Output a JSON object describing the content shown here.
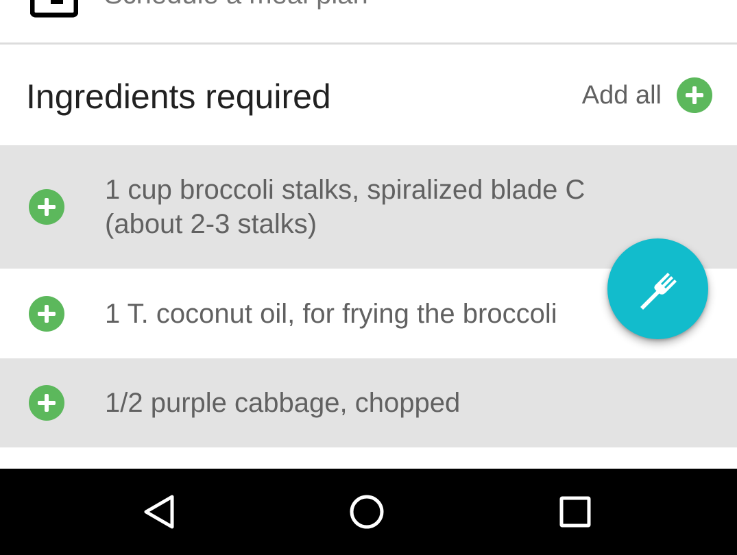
{
  "top_row": {
    "label": "Schedule a meal plan",
    "icon": "calendar-icon"
  },
  "ingredients": {
    "title": "Ingredients required",
    "add_all_label": "Add all",
    "add_icon": "plus-circle-icon",
    "items": [
      {
        "text": "1 cup broccoli stalks, spiralized blade C (about 2-3 stalks)",
        "shaded": true
      },
      {
        "text": "1 T. coconut oil, for frying the broccoli",
        "shaded": false
      },
      {
        "text": "1/2 purple cabbage, chopped",
        "shaded": true
      }
    ]
  },
  "fab": {
    "icon": "fork-icon",
    "color": "#12bccc"
  },
  "nav": {
    "back_icon": "back-triangle-icon",
    "home_icon": "home-circle-icon",
    "recents_icon": "recents-square-icon"
  },
  "colors": {
    "accent_green": "#5cb85c",
    "row_shaded": "#e3e3e3",
    "fab_teal": "#12bccc"
  }
}
